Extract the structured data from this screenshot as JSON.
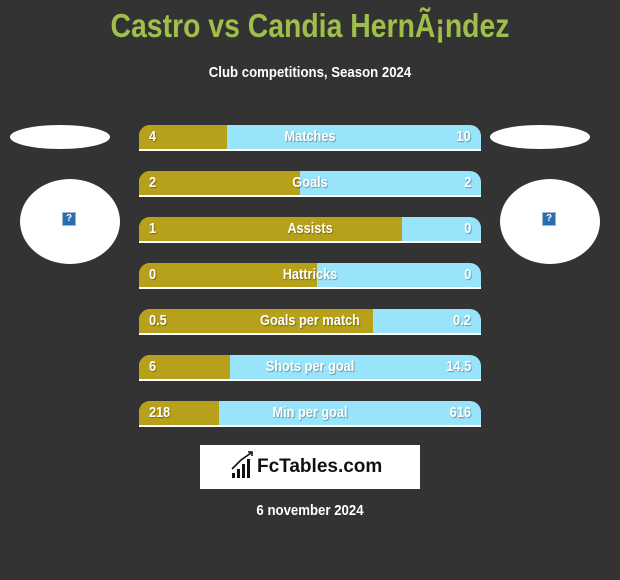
{
  "header": {
    "title": "Castro vs Candia HernÃ¡ndez",
    "subtitle": "Club competitions, Season 2024"
  },
  "players": {
    "left": {
      "avatar_icon": "missing-image-icon",
      "glyph": "?"
    },
    "right": {
      "avatar_icon": "missing-image-icon",
      "glyph": "?"
    }
  },
  "colors": {
    "background": "#333333",
    "title": "#9fbf4a",
    "left_bar": "#b8a11a",
    "right_bar": "#98e4fa"
  },
  "stats": [
    {
      "label": "Matches",
      "left": "4",
      "right": "10",
      "left_fraction": 0.257
    },
    {
      "label": "Goals",
      "left": "2",
      "right": "2",
      "left_fraction": 0.47
    },
    {
      "label": "Assists",
      "left": "1",
      "right": "0",
      "left_fraction": 0.77
    },
    {
      "label": "Hattricks",
      "left": "0",
      "right": "0",
      "left_fraction": 0.52
    },
    {
      "label": "Goals per match",
      "left": "0.5",
      "right": "0.2",
      "left_fraction": 0.685
    },
    {
      "label": "Shots per goal",
      "left": "6",
      "right": "14.5",
      "left_fraction": 0.266
    },
    {
      "label": "Min per goal",
      "left": "218",
      "right": "616",
      "left_fraction": 0.234
    }
  ],
  "footer": {
    "logo_text": "FcTables.com",
    "logo_icon": "bar-chart-trend-icon",
    "date": "6 november 2024"
  }
}
